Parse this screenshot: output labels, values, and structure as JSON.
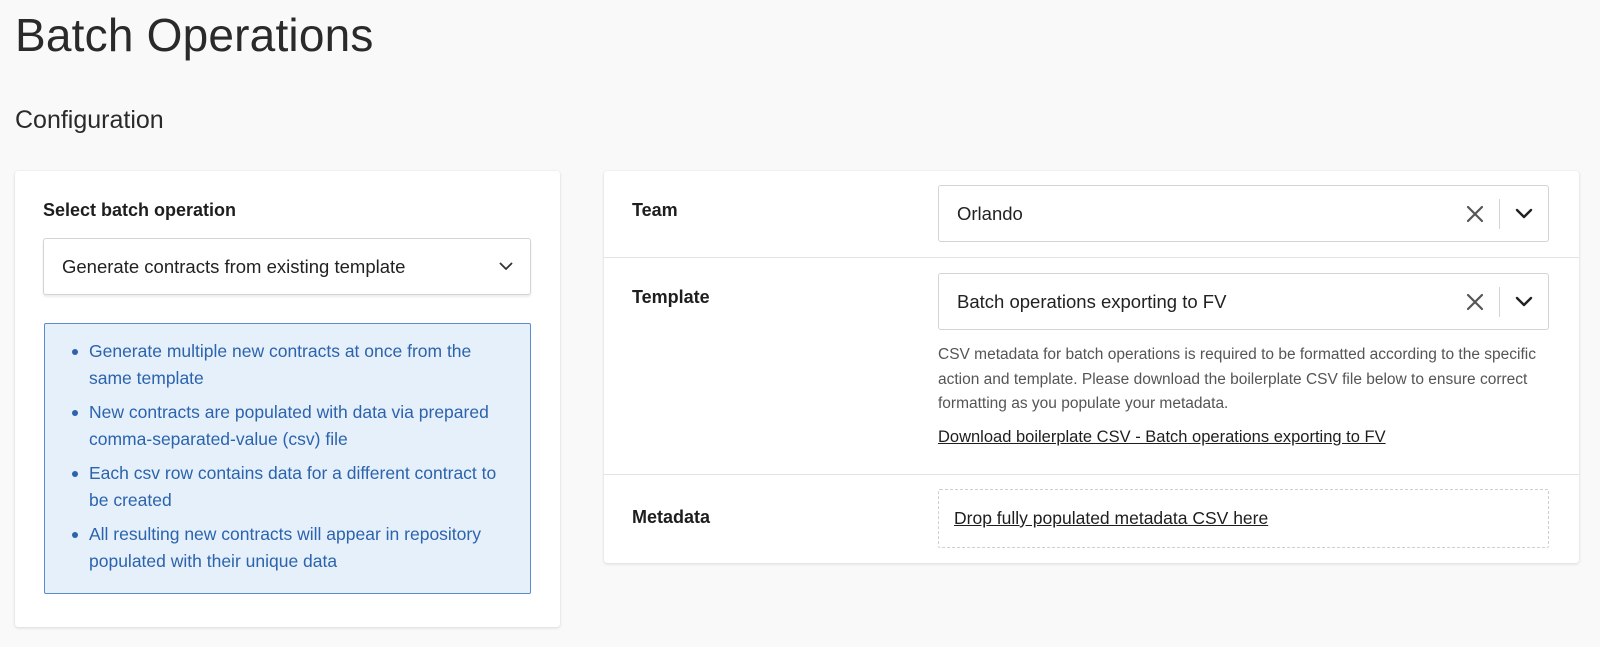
{
  "page": {
    "title": "Batch Operations",
    "section_title": "Configuration"
  },
  "left_card": {
    "label": "Select batch operation",
    "select_value": "Generate contracts from existing template",
    "info_items": [
      "Generate multiple new contracts at once from the same template",
      "New contracts are populated with data via prepared comma-separated-value (csv) file",
      "Each csv row contains data for a different contract to be created",
      "All resulting new contracts will appear in repository populated with their unique data"
    ]
  },
  "right_card": {
    "team": {
      "label": "Team",
      "value": "Orlando"
    },
    "template": {
      "label": "Template",
      "value": "Batch operations exporting to FV",
      "help_text": "CSV metadata for batch operations is required to be formatted according to the specific action and template. Please download the boilerplate CSV file below to ensure correct formatting as you populate your metadata.",
      "download_link": "Download boilerplate CSV - Batch operations exporting to FV"
    },
    "metadata": {
      "label": "Metadata",
      "dropzone_text": "Drop fully populated metadata CSV here"
    }
  },
  "icons": {
    "clear": "close-icon",
    "dropdown": "chevron-down-icon"
  },
  "colors": {
    "info_text": "#2b63ad",
    "info_bg": "#e6f0fb",
    "info_border": "#5b8ccc",
    "page_bg": "#f9f9f9"
  }
}
